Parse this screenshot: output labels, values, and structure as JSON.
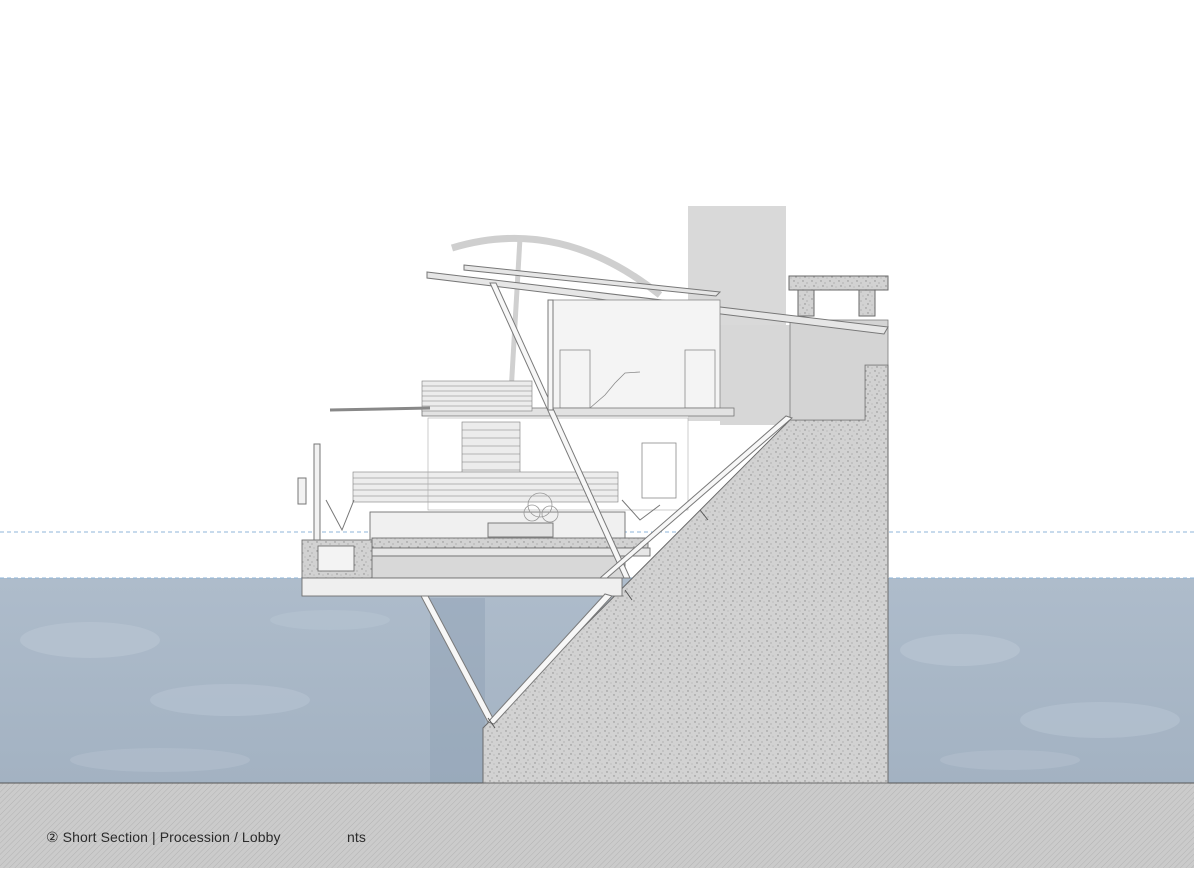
{
  "drawing": {
    "caption": "② Short Section | Procession / Lobby",
    "scale_note": "nts"
  },
  "colors": {
    "sky": "#ffffff",
    "water": "#a9b7c6",
    "water_light": "#c3ceda",
    "ground": "#c8c8c8",
    "concrete": "#cfcfcf",
    "structure": "#d4d4d4",
    "line": "#6f6f6f",
    "datum_line": "#8fb6d8"
  }
}
